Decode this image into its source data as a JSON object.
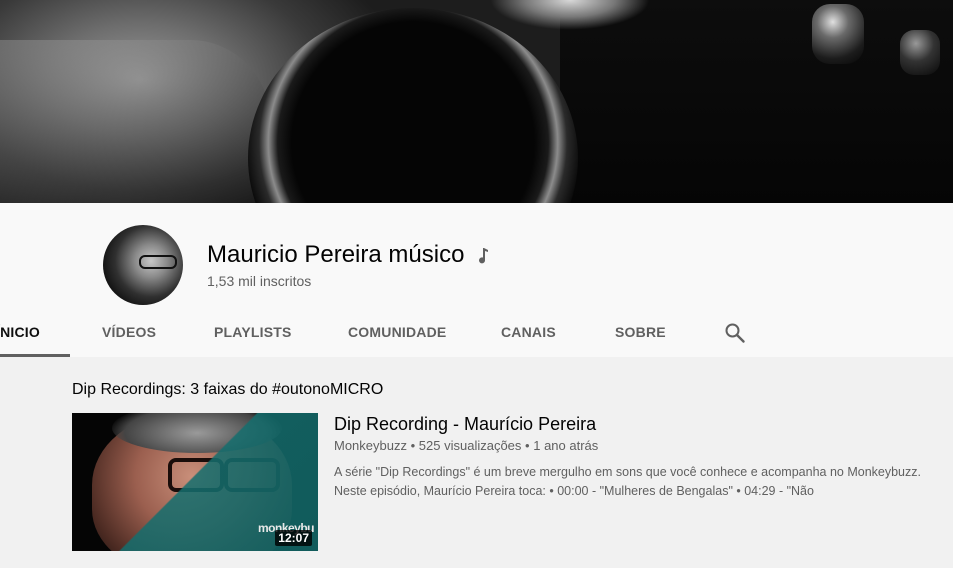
{
  "channel": {
    "name": "Mauricio Pereira músico",
    "subscribers": "1,53 mil inscritos",
    "badge_icon": "music-note-icon"
  },
  "tabs": [
    {
      "label": "ÍNICIO",
      "active": true
    },
    {
      "label": "VÍDEOS",
      "active": false
    },
    {
      "label": "PLAYLISTS",
      "active": false
    },
    {
      "label": "COMUNIDADE",
      "active": false
    },
    {
      "label": "CANAIS",
      "active": false
    },
    {
      "label": "SOBRE",
      "active": false
    }
  ],
  "search_icon": "search-icon",
  "section": {
    "title": "Dip Recordings: 3 faixas do #outonoMICRO"
  },
  "video": {
    "title": "Dip Recording - Maurício Pereira",
    "channel": "Monkeybuzz",
    "views": "525 visualizações",
    "age": "1 ano atrás",
    "separator": "•",
    "duration": "12:07",
    "thumb_logo": "monkeybu",
    "description": "A série \"Dip Recordings\" é um breve mergulho em sons que você conhece e acompanha no Monkeybuzz. Neste episódio, Maurício Pereira toca: • 00:00 - \"Mulheres de Bengalas\" • 04:29 - \"Não"
  },
  "colors": {
    "tab_active_underline": "#606060",
    "secondary_text": "#606060",
    "header_bg": "#f9f9f9",
    "page_bg": "#f1f1f1"
  }
}
